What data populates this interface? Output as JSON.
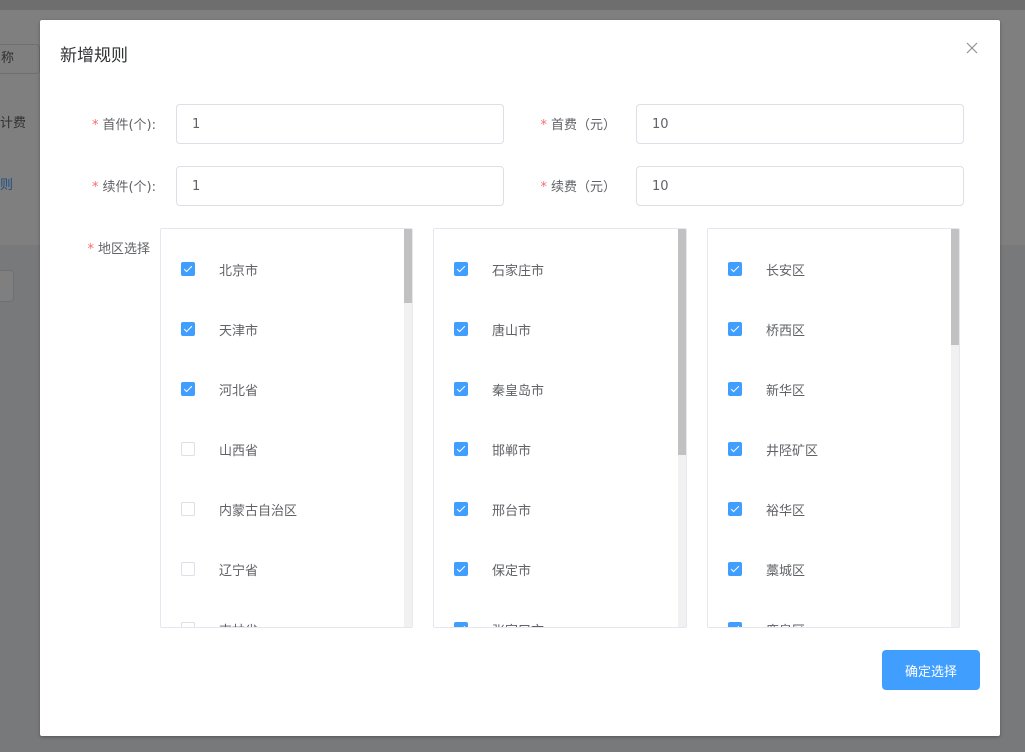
{
  "background": {
    "field_text": "称",
    "row1_text": "计费",
    "row2_text": "则"
  },
  "dialog": {
    "title": "新增规则",
    "close_icon": "close-icon",
    "fields": {
      "first_item": {
        "label": "首件(个):",
        "value": "1"
      },
      "first_fee": {
        "label": "首费（元）",
        "value": "10"
      },
      "next_item": {
        "label": "续件(个):",
        "value": "1"
      },
      "next_fee": {
        "label": "续费（元）",
        "value": "10"
      },
      "region": {
        "label": "地区选择"
      }
    },
    "provinces": [
      {
        "name": "北京市",
        "checked": true
      },
      {
        "name": "天津市",
        "checked": true
      },
      {
        "name": "河北省",
        "checked": true
      },
      {
        "name": "山西省",
        "checked": false
      },
      {
        "name": "内蒙古自治区",
        "checked": false
      },
      {
        "name": "辽宁省",
        "checked": false
      },
      {
        "name": "吉林省",
        "checked": false
      }
    ],
    "cities": [
      {
        "name": "石家庄市",
        "checked": true
      },
      {
        "name": "唐山市",
        "checked": true
      },
      {
        "name": "秦皇岛市",
        "checked": true
      },
      {
        "name": "邯郸市",
        "checked": true
      },
      {
        "name": "邢台市",
        "checked": true
      },
      {
        "name": "保定市",
        "checked": true
      },
      {
        "name": "张家口市",
        "checked": true
      }
    ],
    "districts": [
      {
        "name": "长安区",
        "checked": true
      },
      {
        "name": "桥西区",
        "checked": true
      },
      {
        "name": "新华区",
        "checked": true
      },
      {
        "name": "井陉矿区",
        "checked": true
      },
      {
        "name": "裕华区",
        "checked": true
      },
      {
        "name": "藁城区",
        "checked": true
      },
      {
        "name": "鹿泉区",
        "checked": true
      }
    ],
    "confirm_label": "确定选择",
    "colors": {
      "primary": "#409eff",
      "required": "#f56c6c"
    }
  }
}
